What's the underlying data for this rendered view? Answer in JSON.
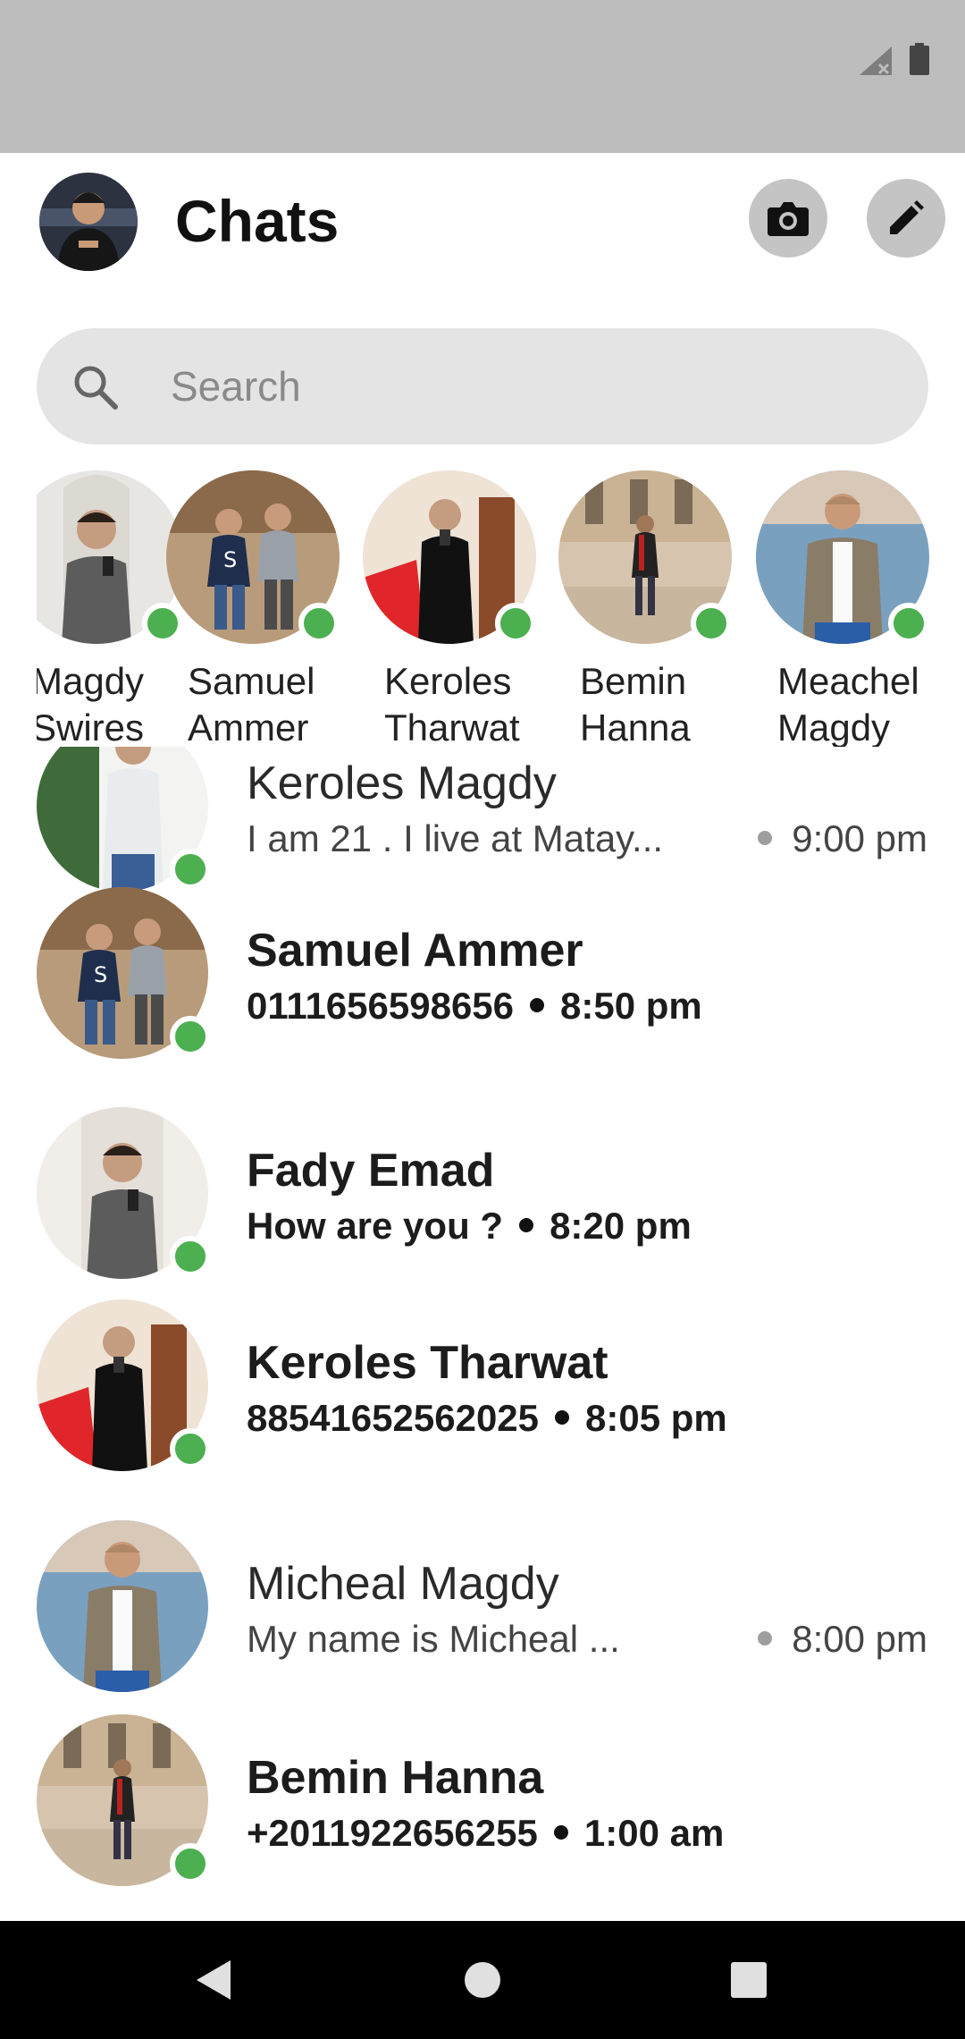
{
  "header": {
    "title": "Chats",
    "camera_icon": "camera-icon",
    "compose_icon": "pencil-icon"
  },
  "search": {
    "placeholder": "Search",
    "icon": "search-icon"
  },
  "stories": [
    {
      "name_line1": "Magdy",
      "name_line2": "Swires",
      "online": true
    },
    {
      "name_line1": "Samuel",
      "name_line2": "Ammer",
      "online": true
    },
    {
      "name_line1": "Keroles",
      "name_line2": "Tharwat",
      "online": true
    },
    {
      "name_line1": "Bemin",
      "name_line2": "Hanna",
      "online": true
    },
    {
      "name_line1": "Meachel",
      "name_line2": "Magdy",
      "online": true
    }
  ],
  "chats": [
    {
      "name": "Keroles Magdy",
      "snippet": "I am 21 . I live at Matay...",
      "time": "9:00 pm",
      "unread": false,
      "online": true
    },
    {
      "name": "Samuel Ammer",
      "snippet": "0111656598656",
      "time": "8:50 pm",
      "unread": true,
      "online": true
    },
    {
      "name": "Fady Emad",
      "snippet": "How are you ?",
      "time": "8:20 pm",
      "unread": true,
      "online": true
    },
    {
      "name": "Keroles Tharwat",
      "snippet": "88541652562025",
      "time": "8:05 pm",
      "unread": true,
      "online": true
    },
    {
      "name": "Micheal Magdy",
      "snippet": "My name is Micheal ...",
      "time": "8:00 pm",
      "unread": false,
      "online": false
    },
    {
      "name": "Bemin Hanna",
      "snippet": "+2011922656255",
      "time": "1:00 am",
      "unread": true,
      "online": true
    }
  ],
  "colors": {
    "status_bar": "#bdbdbd",
    "online": "#4caf50",
    "search_bg": "#e4e4e4",
    "button_bg": "#c4c4c4"
  }
}
